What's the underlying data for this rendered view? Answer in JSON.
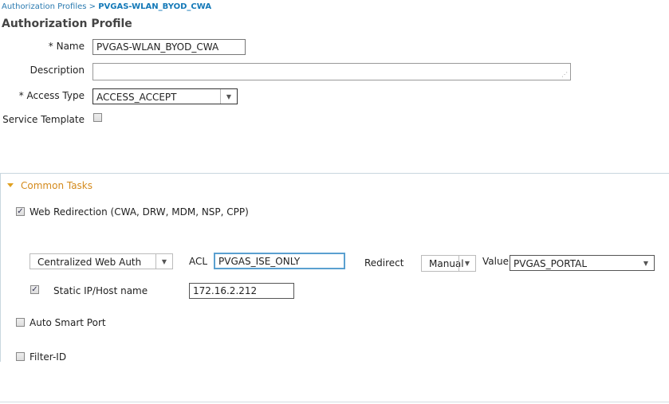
{
  "breadcrumb": {
    "parent": "Authorization Profiles",
    "separator": " > ",
    "current": "PVGAS-WLAN_BYOD_CWA"
  },
  "page_title": "Authorization Profile",
  "form": {
    "name_label": "* Name",
    "name_value": "PVGAS-WLAN_BYOD_CWA",
    "description_label": "Description",
    "description_value": "",
    "access_type_label": "* Access Type",
    "access_type_value": "ACCESS_ACCEPT",
    "service_template_label": "Service Template",
    "service_template_checked": false
  },
  "common_tasks": {
    "header": "Common Tasks",
    "web_redirection": {
      "label": "Web Redirection (CWA, DRW, MDM, NSP, CPP)",
      "checked": true,
      "type_value": "Centralized Web Auth",
      "acl_label": "ACL",
      "acl_value": "PVGAS_ISE_ONLY",
      "redirect_label": "Redirect",
      "redirect_value": "Manual",
      "value_label": "Value",
      "value_value": "PVGAS_PORTAL",
      "static_ip_label": "Static IP/Host name",
      "static_ip_checked": true,
      "static_ip_value": "172.16.2.212"
    },
    "auto_smart_port": {
      "label": "Auto Smart Port",
      "checked": false
    },
    "filter_id": {
      "label": "Filter-ID",
      "checked": false
    }
  },
  "colors": {
    "link": "#1479b8",
    "section_header": "#d48a1c",
    "focus": "#5aa0d0"
  }
}
